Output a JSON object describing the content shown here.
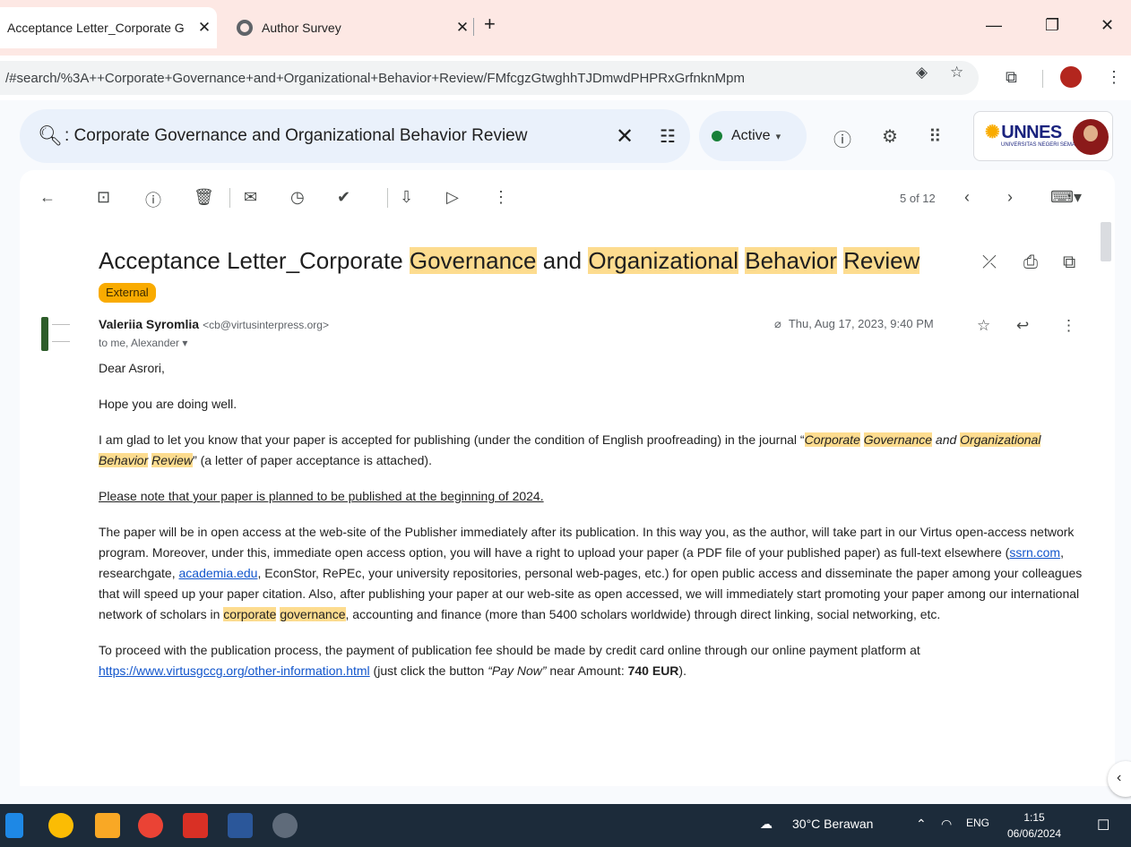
{
  "browser": {
    "tabs": [
      {
        "title": "Acceptance Letter_Corporate G",
        "active": true
      },
      {
        "title": "Author Survey",
        "active": false
      }
    ],
    "url": "/#search/%3A++Corporate+Governance+and+Organizational+Behavior+Review/FMfcgzGtwghhTJDmwdPHPRxGrfnknMpm"
  },
  "gmail": {
    "search_query": ": Corporate Governance and Organizational Behavior Review",
    "status": "Active",
    "org_logo": "UNNES",
    "org_sub": "UNIVERSITAS NEGERI SEMARANG",
    "pager": "5 of 12"
  },
  "email": {
    "subject_parts": {
      "p1": "Acceptance Letter_Corporate ",
      "h1": "Governance",
      "p2": " and ",
      "h2": "Organizational",
      "p3": " ",
      "h3": "Behavior",
      "p4": " ",
      "h4": "Review"
    },
    "label": "External",
    "sender_name": "Valeriia Syromlia",
    "sender_email": "<cb@virtusinterpress.org>",
    "to": "to me, Alexander",
    "date": "Thu, Aug 17, 2023, 9:40 PM",
    "body": {
      "greeting": "Dear Asrori,",
      "hope": "Hope you are doing well.",
      "p3a": "I am glad to let you know that your paper is accepted for publishing (under the condition of English proofreading) in the journal “",
      "p3_corp": "Corporate",
      "p3_sp1": " ",
      "p3_gov": "Governance",
      "p3_and": " and ",
      "p3_org": "Organizational",
      "p3_sp2": " ",
      "p3_beh": "Behavior",
      "p3_sp3": " ",
      "p3_rev": "Review",
      "p3b": "” (a letter of paper acceptance is attached).",
      "note": "Please note that your paper is planned to be published at the beginning of 2024.",
      "p5a": "The paper will be in open access at the web-site of the Publisher immediately after its publication. In this way you, as the author, will take part in our Virtus open-access network program. Moreover, under this, immediate open access option, you will have a right to upload your paper (a PDF file of your published paper) as full-text elsewhere (",
      "link_ssrn": "ssrn.com",
      "p5b": ", researchgate, ",
      "link_academia": "academia.edu",
      "p5c": ", EconStor, RePEc, your university repositories, personal web-pages, etc.) for open public access and disseminate the paper among your colleagues that will speed up your paper citation. Also, after publishing your paper at our web-site as open accessed, we will immediately start promoting your paper among our international network of scholars in ",
      "p5_corp": "corporate",
      "p5_sp": " ",
      "p5_gov": "governance",
      "p5d": ", accounting and finance (more than 5400 scholars worldwide) through direct linking, social networking, etc.",
      "p6a": "To proceed with the publication process, the payment of publication fee should be made by credit card online through our online payment platform at ",
      "link_pay": "https://www.virtusgccg.org/other-information.html",
      "p6b": " (just click the button ",
      "p6_btn": "“Pay Now”",
      "p6c": " near Amount: ",
      "p6_amount": "740 EUR",
      "p6d": ")."
    }
  },
  "taskbar": {
    "weather": "30°C  Berawan",
    "lang": "ENG",
    "time": "1:15",
    "date": "06/06/2024"
  },
  "colors": {
    "highlight": "#fddc8f",
    "label": "#f9ab00",
    "link": "#1155cc",
    "active_dot": "#188038"
  }
}
